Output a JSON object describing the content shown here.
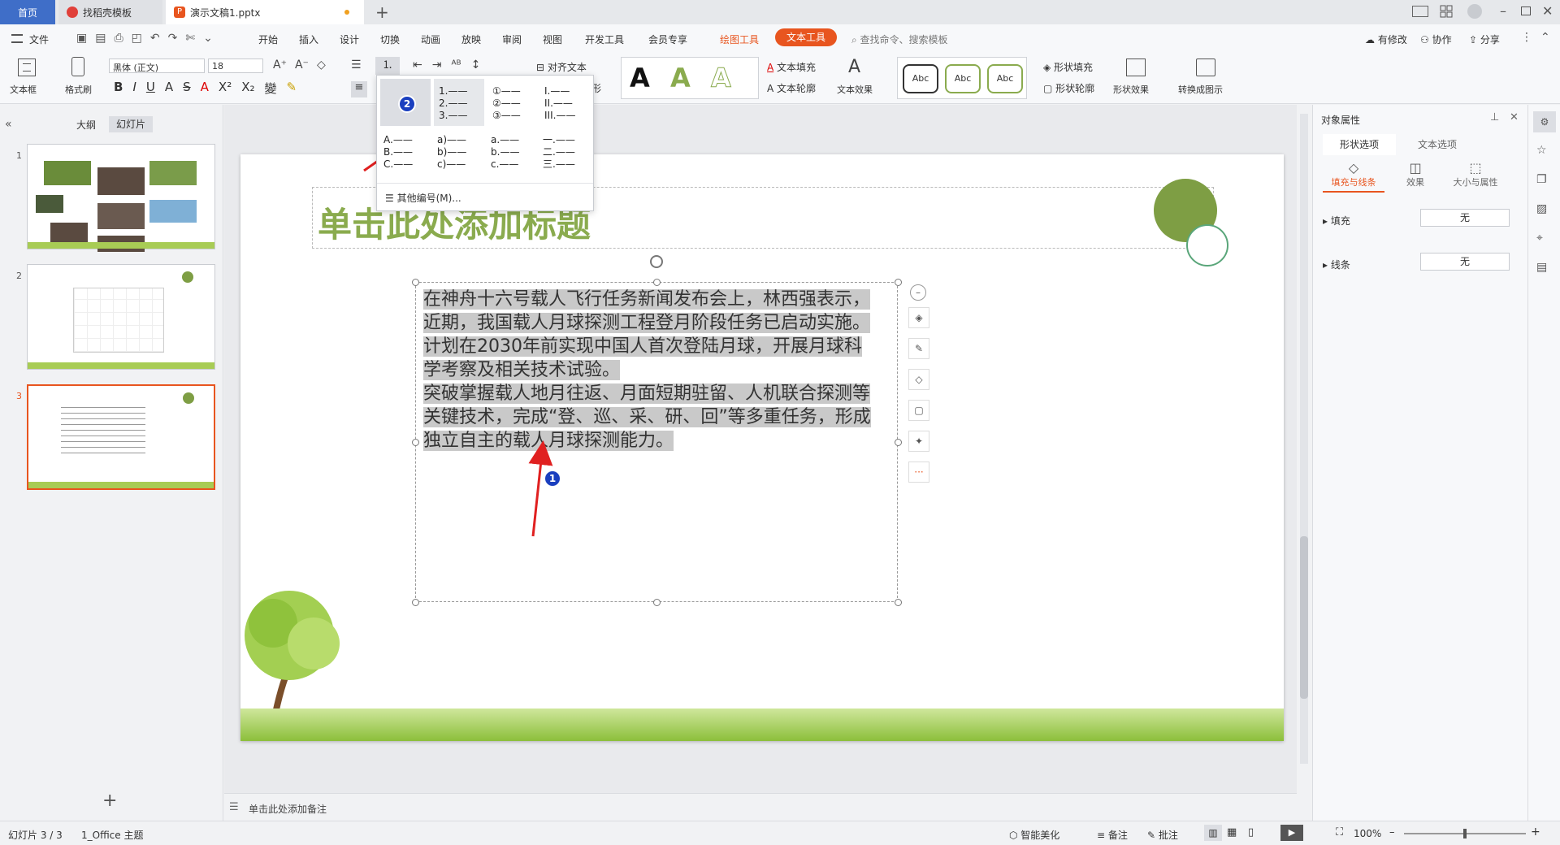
{
  "tabs": [
    {
      "label": "首页",
      "active": false
    },
    {
      "label": "找稻壳模板",
      "active": false
    },
    {
      "label": "演示文稿1.pptx",
      "active": true
    }
  ],
  "menu": {
    "file": "文件",
    "items": [
      "开始",
      "插入",
      "设计",
      "切换",
      "动画",
      "放映",
      "审阅",
      "视图",
      "开发工具",
      "会员专享"
    ],
    "context_tabs": [
      "绘图工具",
      "文本工具"
    ],
    "search_placeholder": "查找命令、搜索模板",
    "right": [
      "有修改",
      "协作",
      "分享"
    ]
  },
  "ribbon": {
    "textbox": "文本框",
    "format_painter": "格式刷",
    "font_name": "黑体 (正文)",
    "font_size": "18",
    "align_text": "对齐文本",
    "text_fill": "文本填充",
    "text_outline": "文本轮廓",
    "text_effect": "文本效果",
    "abc": [
      "Abc",
      "Abc",
      "Abc"
    ],
    "shape_fill": "形状填充",
    "shape_outline": "形状轮廓",
    "shape_effect": "形状效果",
    "convert": "转换成图示",
    "shape_suffix": "形"
  },
  "numbering_dropdown": {
    "row1": [
      [
        "1.",
        "2.",
        "3."
      ],
      [
        "①",
        "②",
        "③"
      ],
      [
        "I.",
        "II.",
        "III."
      ]
    ],
    "row2": [
      [
        "A.",
        "B.",
        "C."
      ],
      [
        "a)",
        "b)",
        "c)"
      ],
      [
        "a.",
        "b.",
        "c."
      ],
      [
        "一.",
        "二.",
        "三."
      ]
    ],
    "more": "其他编号(M)...",
    "badge": "2"
  },
  "left_pane": {
    "outline_tab": "大纲",
    "slides_tab": "幻灯片",
    "slide_numbers": [
      "1",
      "2",
      "3"
    ]
  },
  "slide": {
    "title_placeholder": "单击此处添加标题",
    "paragraphs": [
      "在神舟十六号载人飞行任务新闻发布会上，林西强表示，近期，我国载人月球探测工程登月阶段任务已启动实施。",
      "计划在2030年前实现中国人首次登陆月球，开展月球科学考察及相关技术试验。",
      "突破掌握载人地月往返、月面短期驻留、人机联合探测等关键技术，完成“登、巡、采、研、回”等多重任务，形成独立自主的载人月球探测能力。"
    ],
    "badge": "1"
  },
  "notes_placeholder": "单击此处添加备注",
  "right_pane": {
    "title": "对象属性",
    "tabs": [
      "形状选项",
      "文本选项"
    ],
    "sub_tabs": [
      "填充与线条",
      "效果",
      "大小与属性"
    ],
    "fill_label": "填充",
    "fill_value": "无",
    "line_label": "线条",
    "line_value": "无"
  },
  "status": {
    "slide_info": "幻灯片 3 / 3",
    "theme": "1_Office 主题",
    "smart": "智能美化",
    "notes": "备注",
    "comments": "批注",
    "zoom": "100%"
  },
  "colors": {
    "accent": "#e8551f",
    "title_green": "#8aab4e",
    "circle": "#7e9e44"
  }
}
